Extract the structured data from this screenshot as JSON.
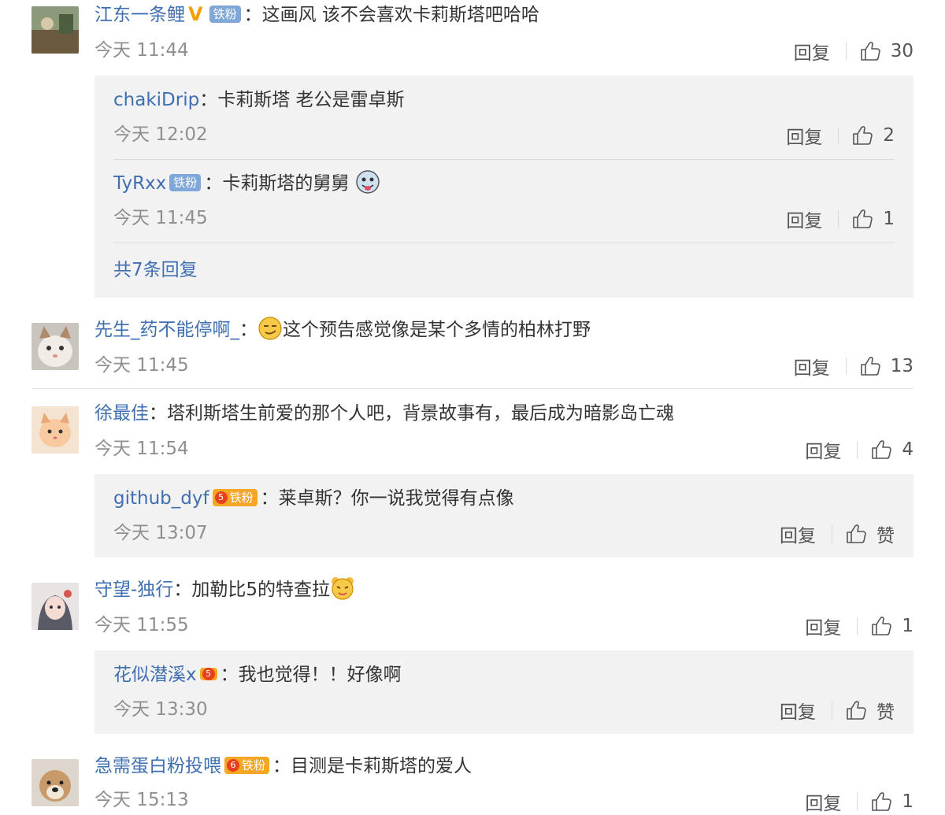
{
  "colors": {
    "link": "#3f6fb0",
    "text": "#333333",
    "muted": "#8f8f8f",
    "subbg": "#f2f2f2",
    "fan_badge": "#7fa8d8",
    "gold_badge": "#f5a623"
  },
  "comments": [
    {
      "user": "江东一条鲤",
      "text": "这画风 该不会喜欢卡莉斯塔吧哈哈",
      "time": "今天 11:44",
      "reply": "回复",
      "likes": "30",
      "avatar": "landscape-avatar",
      "badges": [
        "verified-v",
        "铁粉"
      ],
      "replies": [
        {
          "user": "chakiDrip",
          "text": "卡莉斯塔 老公是雷卓斯",
          "time": "今天 12:02",
          "reply": "回复",
          "likes": "2"
        },
        {
          "user": "TyRxx",
          "badge": "铁粉",
          "text": "卡莉斯塔的舅舅",
          "emoji": "tongue-out-emoji",
          "time": "今天 11:45",
          "reply": "回复",
          "likes": "1"
        }
      ],
      "more": "共7条回复"
    },
    {
      "user": "先生_药不能停啊_",
      "emoji": "smirk-emoji",
      "text": "这个预告感觉像是某个多情的柏林打野",
      "time": "今天 11:45",
      "reply": "回复",
      "likes": "13",
      "avatar": "cat-avatar"
    },
    {
      "user": "徐最佳",
      "text": "塔利斯塔生前爱的那个人吧，背景故事有，最后成为暗影岛亡魂",
      "time": "今天 11:54",
      "reply": "回复",
      "likes": "4",
      "avatar": "kitten-avatar",
      "replies": [
        {
          "user": "github_dyf",
          "badge": "铁粉",
          "badge_level": "5",
          "text": "莱卓斯？你一说我觉得有点像",
          "time": "今天 13:07",
          "reply": "回复",
          "likes": "赞"
        }
      ]
    },
    {
      "user": "守望-独行",
      "text": "加勒比5的特查拉",
      "emoji": "bear-emoji",
      "time": "今天 11:55",
      "reply": "回复",
      "likes": "1",
      "avatar": "anime-girl-avatar",
      "replies": [
        {
          "user": "花似潜溪x",
          "badge_level": "5",
          "text": "我也觉得！！好像啊",
          "time": "今天 13:30",
          "reply": "回复",
          "likes": "赞"
        }
      ]
    },
    {
      "user": "急需蛋白粉投喂",
      "badge": "铁粉",
      "badge_level": "6",
      "text": "目测是卡莉斯塔的爱人",
      "time": "今天 15:13",
      "reply": "回复",
      "likes": "1",
      "avatar": "dog-avatar"
    }
  ],
  "colon": "："
}
